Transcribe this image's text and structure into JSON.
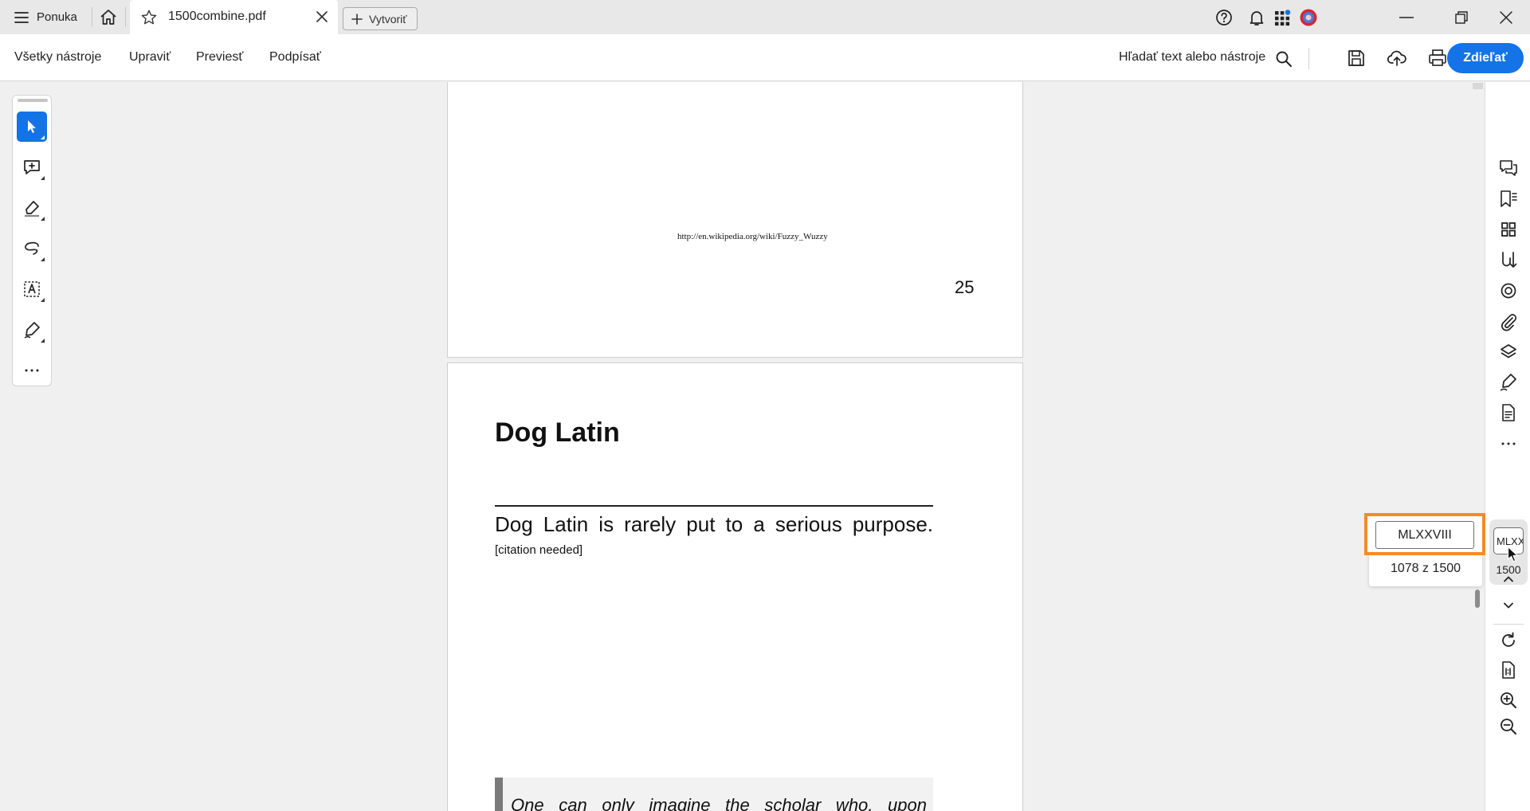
{
  "titlebar": {
    "menu_label": "Ponuka",
    "tab_title": "1500combine.pdf",
    "create_label": "Vytvoriť"
  },
  "toolbar": {
    "menu": [
      "Všetky nástroje",
      "Upraviť",
      "Previesť",
      "Podpísať"
    ],
    "search_label": "Hľadať text alebo nástroje",
    "share_label": "Zdieľať"
  },
  "document": {
    "page_a": {
      "url": "http://en.wikipedia.org/wiki/Fuzzy_Wuzzy",
      "page_number": "25"
    },
    "page_b": {
      "heading": "Dog Latin",
      "body": "Dog Latin is rarely put to a serious purpose.",
      "citation": "[citation needed]",
      "quote": "One can only imagine the scholar who, upon"
    }
  },
  "page_nav": {
    "input_value": "MLXXVIII",
    "count_text": "1078 z 1500",
    "mini_value": "MLXXVIII",
    "total": "1500"
  },
  "colors": {
    "accent": "#1473e6",
    "highlight": "#f28c28"
  }
}
